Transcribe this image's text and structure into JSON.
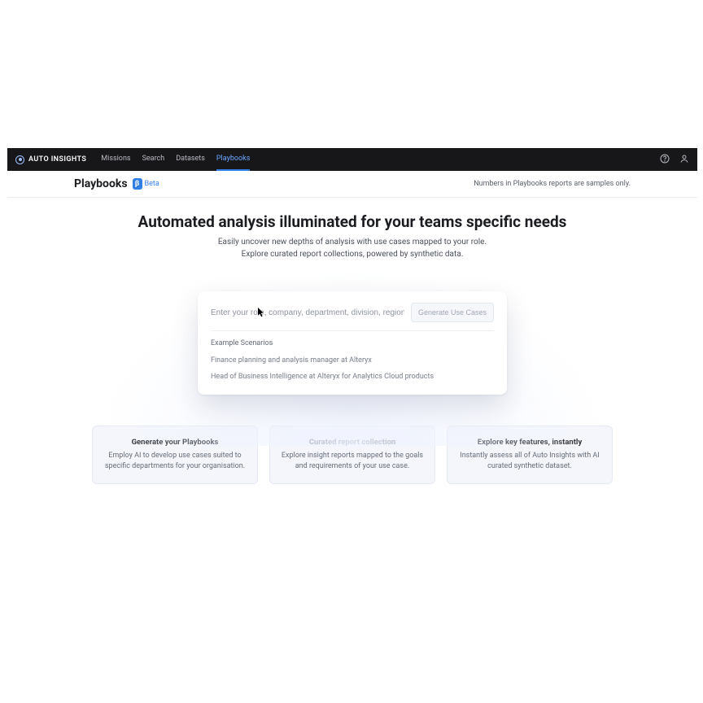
{
  "topbar": {
    "brand": "AUTO INSIGHTS",
    "nav": [
      "Missions",
      "Search",
      "Datasets",
      "Playbooks"
    ],
    "active_nav_index": 3
  },
  "header": {
    "title": "Playbooks",
    "badge_glyph": "β",
    "badge_text": "Beta",
    "note": "Numbers in Playbooks reports are samples only."
  },
  "hero": {
    "title": "Automated analysis illuminated for your teams specific needs",
    "line1": "Easily uncover new depths of analysis with use cases mapped to your role.",
    "line2": "Explore curated report collections, powered by synthetic data."
  },
  "prompt": {
    "placeholder": "Enter your role, company, department, division, region",
    "button": "Generate Use Cases",
    "examples_label": "Example Scenarios",
    "examples": [
      "Finance planning and analysis manager at Alteryx",
      "Head of Business Intelligence at Alteryx for Analytics Cloud products"
    ]
  },
  "features": [
    {
      "title": "Generate your Playbooks",
      "desc": "Employ AI to develop use cases suited to specific departments for your organisation."
    },
    {
      "title": "Curated report collection",
      "desc": "Explore insight reports mapped to the goals and requirements of your use case."
    },
    {
      "title": "Explore key features, instantly",
      "desc": "Instantly assess all of Auto Insights with AI curated synthetic dataset."
    }
  ]
}
